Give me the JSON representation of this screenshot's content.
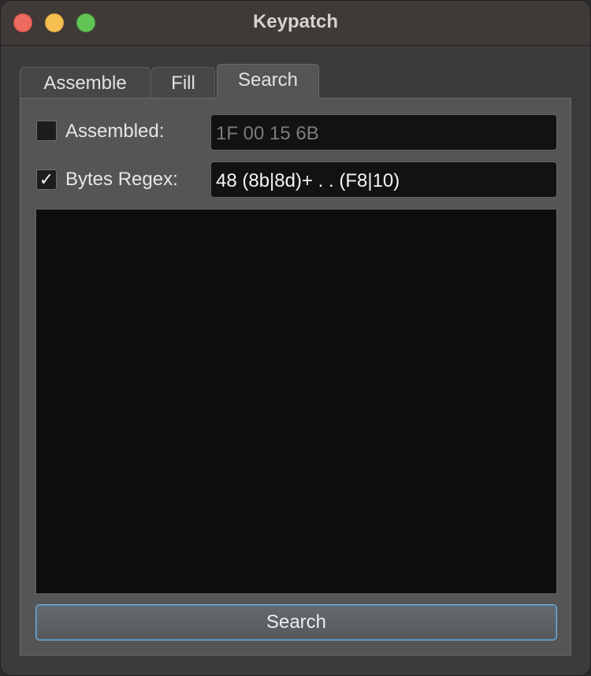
{
  "window": {
    "title": "Keypatch"
  },
  "tabs": [
    {
      "label": "Assemble",
      "selected": false
    },
    {
      "label": "Fill",
      "selected": false
    },
    {
      "label": "Search",
      "selected": true
    }
  ],
  "search_panel": {
    "assembled": {
      "label": "Assembled:",
      "checked": false,
      "value": "1F 00 15 6B"
    },
    "bytes_regex": {
      "label": "Bytes Regex:",
      "checked": true,
      "check_glyph": "✓",
      "value": "48 (8b|8d)+ . . (F8|10)"
    },
    "results": [],
    "search_button_label": "Search"
  },
  "icons": {
    "close": "close-icon",
    "minimize": "minimize-icon",
    "zoom": "zoom-icon"
  },
  "colors": {
    "close": "#ed6a5e",
    "minimize": "#f5bf4f",
    "zoom": "#61c554",
    "button_focus": "#7ab1d6"
  }
}
